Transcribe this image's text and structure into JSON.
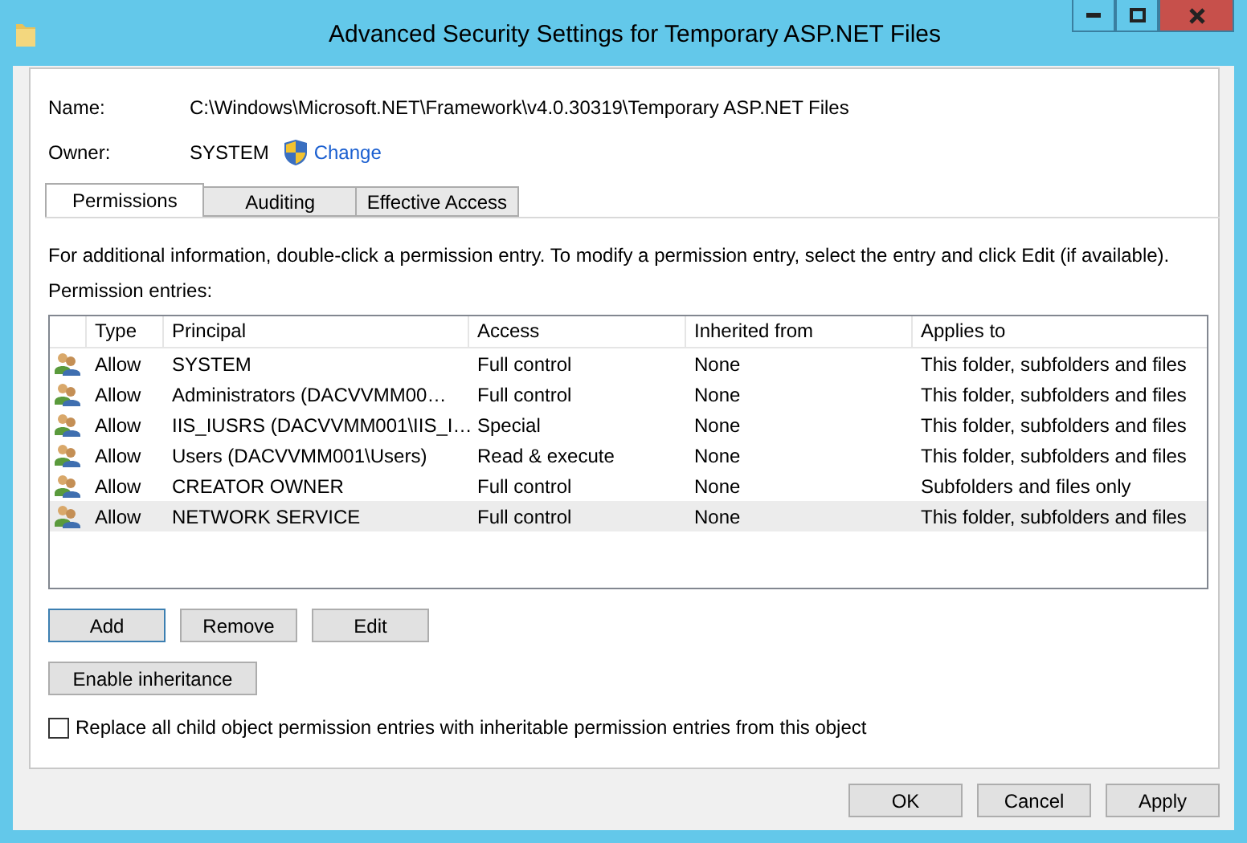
{
  "window": {
    "title": "Advanced Security Settings for Temporary ASP.NET Files"
  },
  "name": {
    "label": "Name:",
    "value": "C:\\Windows\\Microsoft.NET\\Framework\\v4.0.30319\\Temporary ASP.NET Files"
  },
  "owner": {
    "label": "Owner:",
    "value": "SYSTEM",
    "link": "Change"
  },
  "tabs": [
    {
      "label": "Permissions",
      "selected": true
    },
    {
      "label": "Auditing",
      "selected": false
    },
    {
      "label": "Effective Access",
      "selected": false
    }
  ],
  "info": "For additional information, double-click a permission entry. To modify a permission entry, select the entry and click Edit (if available).",
  "entries_label": "Permission entries:",
  "table": {
    "columns": [
      "Type",
      "Principal",
      "Access",
      "Inherited from",
      "Applies to"
    ],
    "rows": [
      {
        "type": "Allow",
        "principal": "SYSTEM",
        "access": "Full control",
        "inherited": "None",
        "applies": "This folder, subfolders and files",
        "selected": false
      },
      {
        "type": "Allow",
        "principal": "Administrators (DACVVMM00…",
        "access": "Full control",
        "inherited": "None",
        "applies": "This folder, subfolders and files",
        "selected": false
      },
      {
        "type": "Allow",
        "principal": "IIS_IUSRS (DACVVMM001\\IIS_I…",
        "access": "Special",
        "inherited": "None",
        "applies": "This folder, subfolders and files",
        "selected": false
      },
      {
        "type": "Allow",
        "principal": "Users (DACVVMM001\\Users)",
        "access": "Read & execute",
        "inherited": "None",
        "applies": "This folder, subfolders and files",
        "selected": false
      },
      {
        "type": "Allow",
        "principal": "CREATOR OWNER",
        "access": "Full control",
        "inherited": "None",
        "applies": "Subfolders and files only",
        "selected": false
      },
      {
        "type": "Allow",
        "principal": "NETWORK SERVICE",
        "access": "Full control",
        "inherited": "None",
        "applies": "This folder, subfolders and files",
        "selected": true
      }
    ]
  },
  "entry_buttons": [
    {
      "label": "Add",
      "focused": true
    },
    {
      "label": "Remove",
      "focused": false
    },
    {
      "label": "Edit",
      "focused": false
    }
  ],
  "inheritance_button": "Enable inheritance",
  "replace_checkbox": {
    "label": "Replace all child object permission entries with inheritable permission entries from this object",
    "checked": false
  },
  "dialog_buttons": [
    "OK",
    "Cancel",
    "Apply"
  ]
}
